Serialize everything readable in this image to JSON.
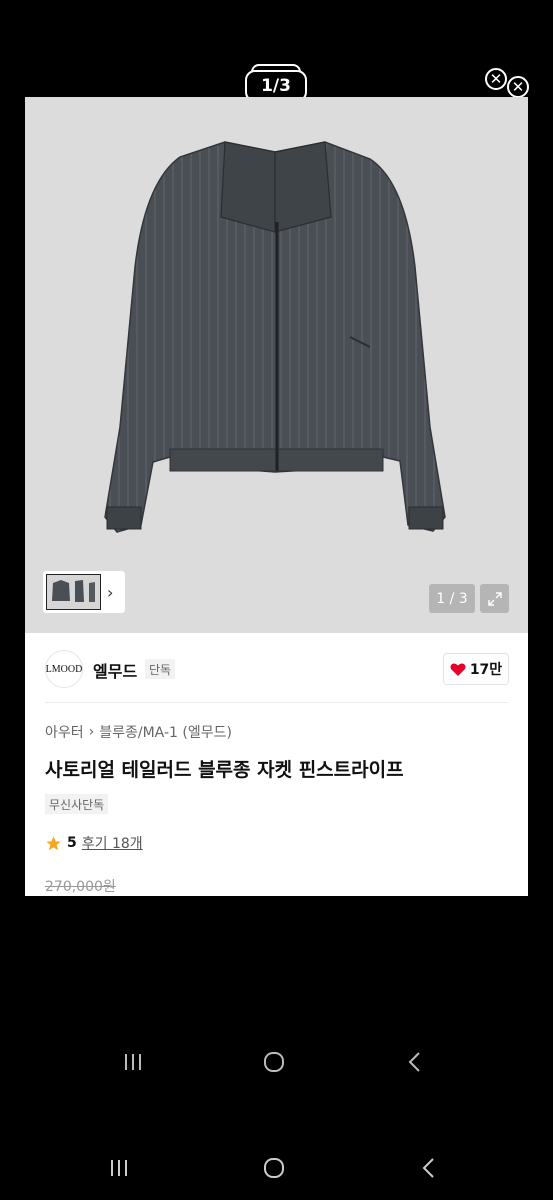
{
  "viewer": {
    "counter": "1/3",
    "close_icon": "close-icon"
  },
  "image": {
    "counter": "1 / 3",
    "expand_icon": "expand-icon"
  },
  "brand": {
    "logo_text": "LMOOD",
    "name": "엘무드",
    "badge": "단독",
    "likes": "17만",
    "heart_color": "#e4002b"
  },
  "product": {
    "breadcrumb": [
      "아우터",
      "블루종/MA-1 (엘무드)"
    ],
    "title": "사토리얼 테일러드 블루종 자켓 핀스트라이프",
    "tag": "무신사단독",
    "rating": "5",
    "review_link": "후기 18개",
    "original_price": "270,000원",
    "star_color": "#f5a623"
  },
  "system_nav": {
    "recents_icon": "recents-icon",
    "home_icon": "home-icon",
    "back_icon": "back-icon"
  }
}
